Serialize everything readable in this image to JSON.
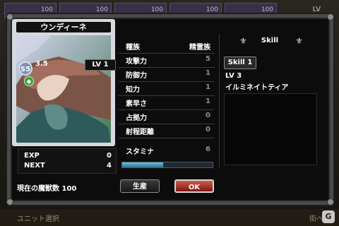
{
  "background": {
    "top_tiles": [
      "100",
      "100",
      "100",
      "100",
      "100"
    ],
    "lv_label": "LV",
    "bottom_left": "ユニット選択",
    "bottom_right": "街へ",
    "brand_glyph": "G"
  },
  "card": {
    "name": "ウンディーネ",
    "rank": "S5",
    "rank_value": "3.5",
    "level": "LV 1",
    "element": "水"
  },
  "progress": {
    "exp_label": "EXP",
    "exp_value": "0",
    "next_label": "NEXT",
    "next_value": "4"
  },
  "magic_beasts": {
    "label": "現在の魔獣数",
    "value": "100"
  },
  "stats": {
    "race": {
      "label": "種族",
      "value": "精霊族"
    },
    "attack": {
      "label": "攻撃力",
      "value": "5"
    },
    "defense": {
      "label": "防御力",
      "value": "1"
    },
    "intelligence": {
      "label": "知力",
      "value": "1"
    },
    "agility": {
      "label": "素早さ",
      "value": "1"
    },
    "occupation": {
      "label": "占拠力",
      "value": "0"
    },
    "range": {
      "label": "射程距離",
      "value": "0"
    },
    "stamina": {
      "label": "スタミナ",
      "value": "6"
    },
    "stamina_fill": 0.45
  },
  "skill": {
    "header": "Skill",
    "tab": "Skill 1",
    "level": "LV 3",
    "name": "イルミネイトティア",
    "description": ""
  },
  "buttons": {
    "produce": "生産",
    "ok": "OK"
  },
  "colors": {
    "ok_button": "#b0362b",
    "stamina_bar": "#4aa3c4",
    "element_water": "#34a23a"
  }
}
